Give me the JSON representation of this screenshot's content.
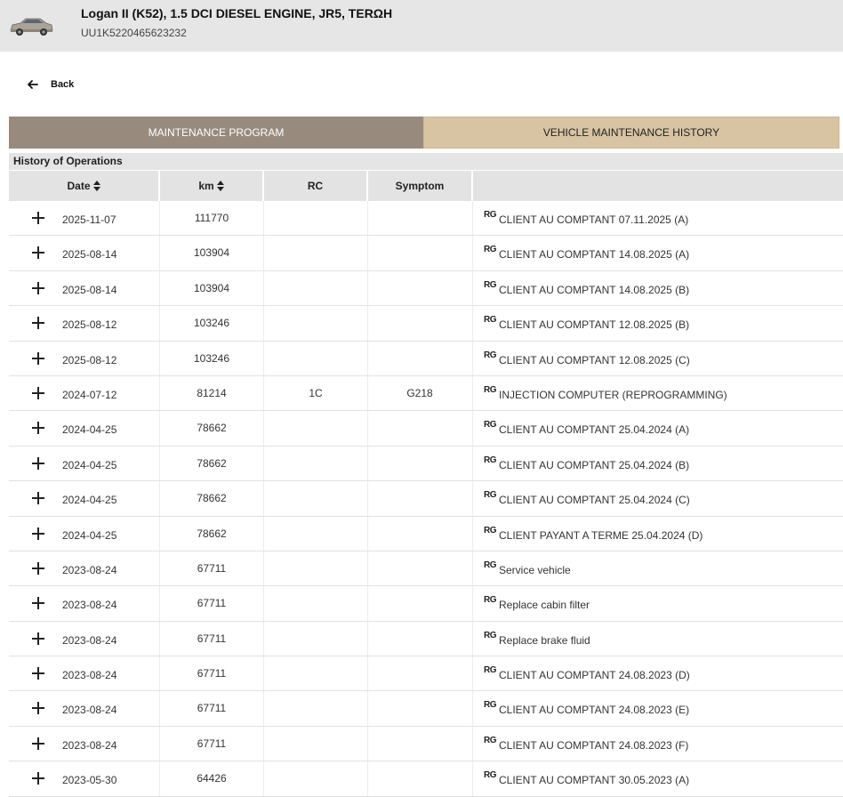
{
  "vehicle": {
    "title": "Logan II (K52), 1.5 DCI DIESEL ENGINE, JR5, TERΩH",
    "vin": "UU1K5220465623232",
    "icon": "car-icon"
  },
  "nav": {
    "back_label": "Back",
    "back_icon": "arrow-left-icon"
  },
  "tabs": [
    {
      "label": "MAINTENANCE PROGRAM",
      "active": true
    },
    {
      "label": "VEHICLE MAINTENANCE HISTORY",
      "active": false
    }
  ],
  "section": {
    "title": "History of Operations"
  },
  "table": {
    "columns": [
      "Date",
      "km",
      "RC",
      "Symptom",
      ""
    ],
    "operation_badge": "RG",
    "rows": [
      {
        "date": "2025-11-07",
        "km": "111770",
        "rc": "",
        "symptom": "",
        "operation": "CLIENT AU COMPTANT 07.11.2025 (A)"
      },
      {
        "date": "2025-08-14",
        "km": "103904",
        "rc": "",
        "symptom": "",
        "operation": "CLIENT AU COMPTANT 14.08.2025 (A)"
      },
      {
        "date": "2025-08-14",
        "km": "103904",
        "rc": "",
        "symptom": "",
        "operation": "CLIENT AU COMPTANT 14.08.2025 (B)"
      },
      {
        "date": "2025-08-12",
        "km": "103246",
        "rc": "",
        "symptom": "",
        "operation": "CLIENT AU COMPTANT 12.08.2025 (B)"
      },
      {
        "date": "2025-08-12",
        "km": "103246",
        "rc": "",
        "symptom": "",
        "operation": "CLIENT AU COMPTANT 12.08.2025 (C)"
      },
      {
        "date": "2024-07-12",
        "km": "81214",
        "rc": "1C",
        "symptom": "G218",
        "operation": "INJECTION COMPUTER (REPROGRAMMING)"
      },
      {
        "date": "2024-04-25",
        "km": "78662",
        "rc": "",
        "symptom": "",
        "operation": "CLIENT AU COMPTANT 25.04.2024 (A)"
      },
      {
        "date": "2024-04-25",
        "km": "78662",
        "rc": "",
        "symptom": "",
        "operation": "CLIENT AU COMPTANT 25.04.2024 (B)"
      },
      {
        "date": "2024-04-25",
        "km": "78662",
        "rc": "",
        "symptom": "",
        "operation": "CLIENT AU COMPTANT 25.04.2024 (C)"
      },
      {
        "date": "2024-04-25",
        "km": "78662",
        "rc": "",
        "symptom": "",
        "operation": "CLIENT PAYANT A TERME 25.04.2024 (D)"
      },
      {
        "date": "2023-08-24",
        "km": "67711",
        "rc": "",
        "symptom": "",
        "operation": "Service vehicle"
      },
      {
        "date": "2023-08-24",
        "km": "67711",
        "rc": "",
        "symptom": "",
        "operation": "Replace cabin filter"
      },
      {
        "date": "2023-08-24",
        "km": "67711",
        "rc": "",
        "symptom": "",
        "operation": "Replace brake fluid"
      },
      {
        "date": "2023-08-24",
        "km": "67711",
        "rc": "",
        "symptom": "",
        "operation": "CLIENT AU COMPTANT 24.08.2023 (D)"
      },
      {
        "date": "2023-08-24",
        "km": "67711",
        "rc": "",
        "symptom": "",
        "operation": "CLIENT AU COMPTANT 24.08.2023 (E)"
      },
      {
        "date": "2023-08-24",
        "km": "67711",
        "rc": "",
        "symptom": "",
        "operation": "CLIENT AU COMPTANT 24.08.2023 (F)"
      },
      {
        "date": "2023-05-30",
        "km": "64426",
        "rc": "",
        "symptom": "",
        "operation": "CLIENT AU COMPTANT 30.05.2023 (A)"
      }
    ]
  },
  "colors": {
    "tab_active": "#988b7d",
    "tab_inactive": "#d8c4a2",
    "header_bg": "#e6e6e6"
  }
}
